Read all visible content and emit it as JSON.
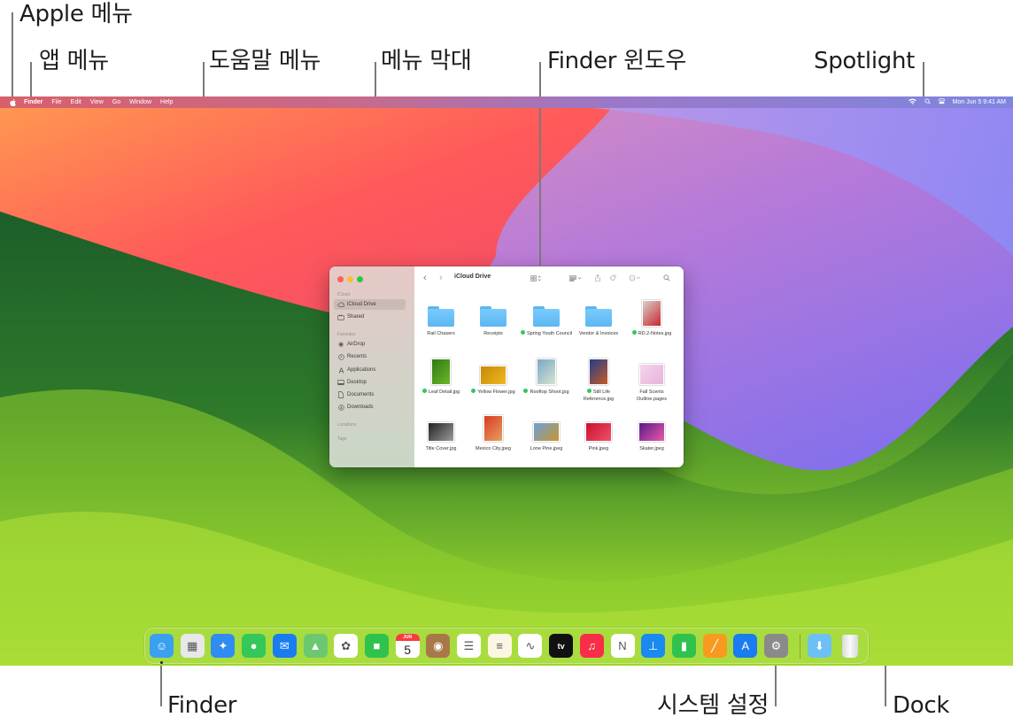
{
  "callouts": {
    "apple_menu": "Apple 메뉴",
    "app_menu": "앱 메뉴",
    "help_menu": "도움말 메뉴",
    "menu_bar": "메뉴 막대",
    "finder_window": "Finder 윈도우",
    "spotlight": "Spotlight",
    "finder": "Finder",
    "system_settings": "시스템 설정",
    "dock": "Dock"
  },
  "menubar": {
    "apple_icon": "apple-logo-icon",
    "items": [
      "Finder",
      "File",
      "Edit",
      "View",
      "Go",
      "Window",
      "Help"
    ],
    "status": {
      "wifi_icon": "wifi-icon",
      "spotlight_icon": "magnifying-glass-icon",
      "control_center_icon": "control-center-icon",
      "datetime": "Mon Jun 5  9:41 AM"
    }
  },
  "finder": {
    "title": "iCloud Drive",
    "sidebar": {
      "sections": [
        {
          "label": "iCloud",
          "items": [
            {
              "label": "iCloud Drive",
              "icon": "cloud-icon",
              "selected": true
            },
            {
              "label": "Shared",
              "icon": "shared-folder-icon",
              "selected": false
            }
          ]
        },
        {
          "label": "Favorites",
          "items": [
            {
              "label": "AirDrop",
              "icon": "airdrop-icon"
            },
            {
              "label": "Recents",
              "icon": "clock-icon"
            },
            {
              "label": "Applications",
              "icon": "applications-icon"
            },
            {
              "label": "Desktop",
              "icon": "desktop-icon"
            },
            {
              "label": "Documents",
              "icon": "document-icon"
            },
            {
              "label": "Downloads",
              "icon": "download-icon"
            }
          ]
        },
        {
          "label": "Locations",
          "items": []
        },
        {
          "label": "Tags",
          "items": []
        }
      ]
    },
    "toolbar": {
      "back": "‹",
      "forward": "›",
      "view_icon": "icon-view-icon",
      "group_icon": "group-icon",
      "share_icon": "share-icon",
      "tag_icon": "tag-icon",
      "more_icon": "more-icon",
      "search_icon": "search-icon"
    },
    "files": [
      {
        "name": "Rail Chasers",
        "kind": "folder",
        "tag": false
      },
      {
        "name": "Receipts",
        "kind": "folder",
        "tag": false
      },
      {
        "name": "Spring Youth Council",
        "kind": "folder",
        "tag": true
      },
      {
        "name": "Vendor & Invoices",
        "kind": "folder",
        "tag": false
      },
      {
        "name": "RD.2-Notes.jpg",
        "kind": "image",
        "tag": true,
        "colors": [
          "#d8d0cc",
          "#c8282e"
        ]
      },
      {
        "name": "Leaf Detail.jpg",
        "kind": "image",
        "tag": true,
        "colors": [
          "#2f7a12",
          "#6cb82a"
        ]
      },
      {
        "name": "Yellow Flower.jpg",
        "kind": "image",
        "tag": true,
        "colors": [
          "#c48a08",
          "#f0b820"
        ]
      },
      {
        "name": "Rooftop Shoot.jpg",
        "kind": "image",
        "tag": true,
        "colors": [
          "#7aa8c8",
          "#d8e2d0"
        ]
      },
      {
        "name": "Still Life Reference.jpg",
        "kind": "image",
        "tag": true,
        "colors": [
          "#1e3e8a",
          "#c85a28"
        ]
      },
      {
        "name": "Fall Scents Outline.pages",
        "kind": "doc",
        "tag": false,
        "colors": [
          "#f4d4ec",
          "#e7b4dc"
        ]
      },
      {
        "name": "Title Cover.jpg",
        "kind": "image",
        "tag": false,
        "colors": [
          "#222222",
          "#9a9a9a"
        ]
      },
      {
        "name": "Mexico City.jpeg",
        "kind": "image",
        "tag": false,
        "colors": [
          "#d83a22",
          "#e8a060"
        ]
      },
      {
        "name": "Lone Pine.jpeg",
        "kind": "image",
        "tag": false,
        "colors": [
          "#6aa0d8",
          "#c8962e"
        ]
      },
      {
        "name": "Pink.jpeg",
        "kind": "image",
        "tag": false,
        "colors": [
          "#c8102e",
          "#f0506a"
        ]
      },
      {
        "name": "Skater.jpeg",
        "kind": "image",
        "tag": false,
        "colors": [
          "#5a1a8a",
          "#e85aa8"
        ]
      }
    ]
  },
  "dock": {
    "apps": [
      {
        "name": "Finder",
        "icon": "finder-icon",
        "running": true,
        "bg": "#3aa0f0",
        "glyph": "☺"
      },
      {
        "name": "Launchpad",
        "icon": "launchpad-icon",
        "bg": "#e8e8e8",
        "glyph": "▦"
      },
      {
        "name": "Safari",
        "icon": "safari-icon",
        "bg": "#2f8cf0",
        "glyph": "✦"
      },
      {
        "name": "Messages",
        "icon": "messages-icon",
        "bg": "#34c759",
        "glyph": "●"
      },
      {
        "name": "Mail",
        "icon": "mail-icon",
        "bg": "#1a7cf0",
        "glyph": "✉"
      },
      {
        "name": "Maps",
        "icon": "maps-icon",
        "bg": "#6cc870",
        "glyph": "▲"
      },
      {
        "name": "Photos",
        "icon": "photos-icon",
        "bg": "#ffffff",
        "glyph": "✿"
      },
      {
        "name": "FaceTime",
        "icon": "facetime-icon",
        "bg": "#2fc34e",
        "glyph": "■"
      },
      {
        "name": "Calendar",
        "icon": "calendar-icon",
        "bg": "#ffffff",
        "glyph": "5",
        "month": "JUN"
      },
      {
        "name": "Contacts",
        "icon": "contacts-icon",
        "bg": "#a8784a",
        "glyph": "◉"
      },
      {
        "name": "Reminders",
        "icon": "reminders-icon",
        "bg": "#ffffff",
        "glyph": "☰"
      },
      {
        "name": "Notes",
        "icon": "notes-icon",
        "bg": "#fbf6e2",
        "glyph": "≡"
      },
      {
        "name": "Freeform",
        "icon": "freeform-icon",
        "bg": "#ffffff",
        "glyph": "∿"
      },
      {
        "name": "TV",
        "icon": "apple-tv-icon",
        "bg": "#111111",
        "glyph": "tv"
      },
      {
        "name": "Music",
        "icon": "music-icon",
        "bg": "#fa2d48",
        "glyph": "♫"
      },
      {
        "name": "News",
        "icon": "news-icon",
        "bg": "#ffffff",
        "glyph": "N"
      },
      {
        "name": "Keynote",
        "icon": "keynote-icon",
        "bg": "#1a8af0",
        "glyph": "⊥"
      },
      {
        "name": "Numbers",
        "icon": "numbers-icon",
        "bg": "#2fc34e",
        "glyph": "▮"
      },
      {
        "name": "Pages",
        "icon": "pages-icon",
        "bg": "#f89a20",
        "glyph": "╱"
      },
      {
        "name": "App Store",
        "icon": "app-store-icon",
        "bg": "#1a7cf0",
        "glyph": "A"
      },
      {
        "name": "System Settings",
        "icon": "system-settings-icon",
        "bg": "#8a8a8a",
        "glyph": "⚙"
      }
    ],
    "extras": [
      {
        "name": "Downloads",
        "icon": "downloads-folder-icon",
        "bg": "#6cc0f4",
        "glyph": "⬇"
      },
      {
        "name": "Trash",
        "icon": "trash-icon",
        "bg": "#f0f0f0",
        "glyph": ""
      }
    ]
  }
}
